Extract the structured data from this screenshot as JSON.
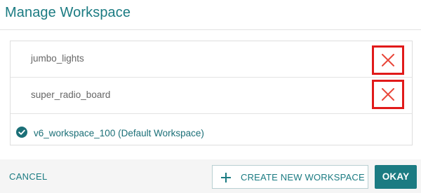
{
  "dialog": {
    "title": "Manage Workspace"
  },
  "workspaces": [
    {
      "name": "jumbo_lights",
      "deletable": true,
      "delete_icon": "close-icon"
    },
    {
      "name": "super_radio_board",
      "deletable": true,
      "delete_icon": "close-icon"
    },
    {
      "name": "v6_workspace_100 (Default Workspace)",
      "selected": true,
      "status_icon": "check-circle-icon"
    }
  ],
  "footer": {
    "cancel_label": "CANCEL",
    "create_label": "CREATE NEW WORKSPACE",
    "create_icon": "plus-icon",
    "okay_label": "OKAY"
  },
  "colors": {
    "accent": "#1b7b82",
    "delete_highlight": "#e11a1a",
    "delete_x": "#e8473a"
  }
}
